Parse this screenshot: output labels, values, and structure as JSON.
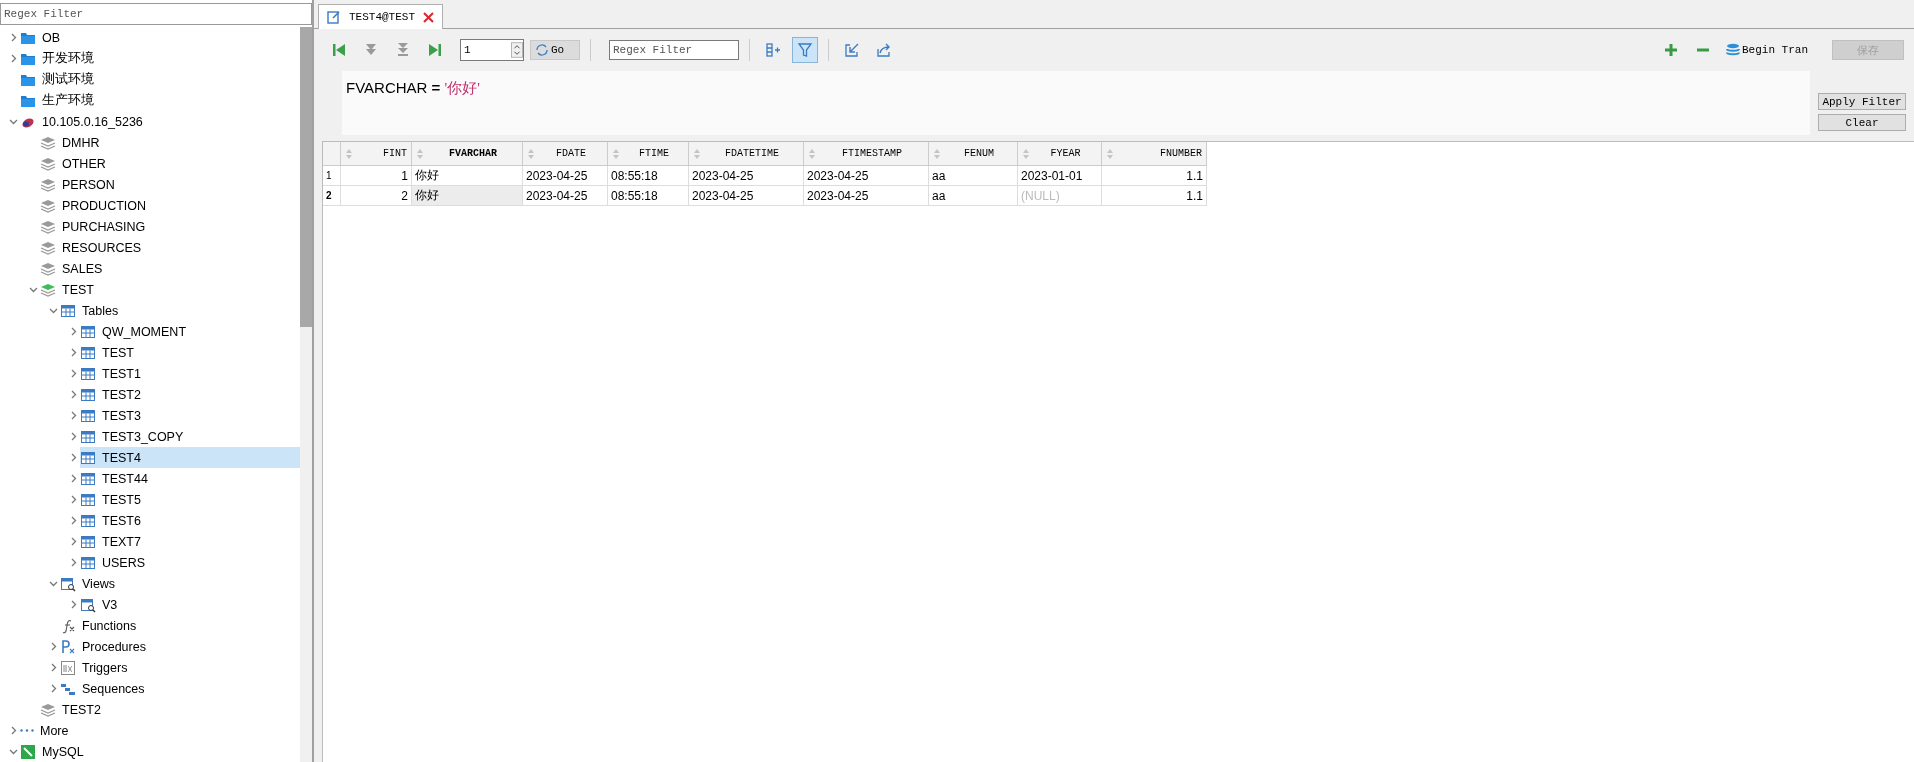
{
  "sidebar": {
    "filter": {
      "placeholder": "Regex Filter"
    },
    "tree": [
      {
        "label": "OB",
        "kind": "folder",
        "expanded": false,
        "selected": false
      },
      {
        "label": "开发环境",
        "kind": "folder",
        "expanded": false,
        "selected": false
      },
      {
        "label": "测试环境",
        "kind": "folder",
        "selected": false
      },
      {
        "label": "生产环境",
        "kind": "folder",
        "selected": false
      },
      {
        "label": "10.105.0.16_5236",
        "kind": "server",
        "expanded": true,
        "selected": false,
        "children": [
          {
            "label": "DMHR",
            "kind": "schema",
            "selected": false
          },
          {
            "label": "OTHER",
            "kind": "schema",
            "selected": false
          },
          {
            "label": "PERSON",
            "kind": "schema",
            "selected": false
          },
          {
            "label": "PRODUCTION",
            "kind": "schema",
            "selected": false
          },
          {
            "label": "PURCHASING",
            "kind": "schema",
            "selected": false
          },
          {
            "label": "RESOURCES",
            "kind": "schema",
            "selected": false
          },
          {
            "label": "SALES",
            "kind": "schema",
            "selected": false
          },
          {
            "label": "TEST",
            "kind": "schema-open",
            "expanded": true,
            "selected": false,
            "children": [
              {
                "label": "Tables",
                "kind": "table",
                "expanded": true,
                "selected": false,
                "children": [
                  {
                    "label": "QW_MOMENT",
                    "kind": "table",
                    "expanded": false,
                    "selected": false
                  },
                  {
                    "label": "TEST",
                    "kind": "table",
                    "expanded": false,
                    "selected": false
                  },
                  {
                    "label": "TEST1",
                    "kind": "table",
                    "expanded": false,
                    "selected": false
                  },
                  {
                    "label": "TEST2",
                    "kind": "table",
                    "expanded": false,
                    "selected": false
                  },
                  {
                    "label": "TEST3",
                    "kind": "table",
                    "expanded": false,
                    "selected": false
                  },
                  {
                    "label": "TEST3_COPY",
                    "kind": "table",
                    "expanded": false,
                    "selected": false
                  },
                  {
                    "label": "TEST4",
                    "kind": "table",
                    "expanded": false,
                    "selected": true
                  },
                  {
                    "label": "TEST44",
                    "kind": "table",
                    "expanded": false,
                    "selected": false
                  },
                  {
                    "label": "TEST5",
                    "kind": "table",
                    "expanded": false,
                    "selected": false
                  },
                  {
                    "label": "TEST6",
                    "kind": "table",
                    "expanded": false,
                    "selected": false
                  },
                  {
                    "label": "TEXT7",
                    "kind": "table",
                    "expanded": false,
                    "selected": false
                  },
                  {
                    "label": "USERS",
                    "kind": "table",
                    "expanded": false,
                    "selected": false
                  }
                ]
              },
              {
                "label": "Views",
                "kind": "view",
                "expanded": true,
                "selected": false,
                "children": [
                  {
                    "label": "V3",
                    "kind": "view",
                    "expanded": false,
                    "selected": false
                  }
                ]
              },
              {
                "label": "Functions",
                "kind": "function",
                "selected": false
              },
              {
                "label": "Procedures",
                "kind": "procedure",
                "expanded": false,
                "selected": false
              },
              {
                "label": "Triggers",
                "kind": "trigger",
                "expanded": false,
                "selected": false
              },
              {
                "label": "Sequences",
                "kind": "sequence",
                "expanded": false,
                "selected": false
              }
            ]
          },
          {
            "label": "TEST2",
            "kind": "schema",
            "selected": false
          }
        ]
      },
      {
        "label": "More",
        "kind": "more",
        "expanded": false,
        "selected": false
      },
      {
        "label": "MySQL",
        "kind": "mysql",
        "expanded": true,
        "selected": false
      }
    ]
  },
  "tabs": [
    {
      "title": "TEST4@TEST",
      "selected": true
    }
  ],
  "toolbar": {
    "nav": [
      {
        "kind": "first",
        "disabled": false
      },
      {
        "kind": "prev",
        "disabled": true
      },
      {
        "kind": "next",
        "disabled": true
      },
      {
        "kind": "last",
        "disabled": false
      }
    ],
    "page": "1",
    "go": "Go",
    "filter": {
      "placeholder": "Regex Filter"
    },
    "filter_on": true,
    "begin_tran": "Begin Tran",
    "save": {
      "label": "保存",
      "disabled": true
    }
  },
  "filter_expression": {
    "column": "FVARCHAR",
    "operator": "=",
    "value": "'你好'"
  },
  "apply_filter": "Apply Filter",
  "clear": "Clear",
  "table": {
    "columns": [
      {
        "name": "FINT",
        "kind": "number",
        "selected": false
      },
      {
        "name": "FVARCHAR",
        "kind": "text",
        "selected": true
      },
      {
        "name": "FDATE",
        "kind": "text",
        "selected": false
      },
      {
        "name": "FTIME",
        "kind": "text",
        "selected": false
      },
      {
        "name": "FDATETIME",
        "kind": "text",
        "selected": false
      },
      {
        "name": "FTIMESTAMP",
        "kind": "text",
        "selected": false
      },
      {
        "name": "FENUM",
        "kind": "text",
        "selected": false
      },
      {
        "name": "FYEAR",
        "kind": "text",
        "selected": false
      },
      {
        "name": "FNUMBER",
        "kind": "number",
        "selected": false
      }
    ],
    "rows": [
      {
        "number": "1",
        "selected": false,
        "cells": [
          {
            "text": "1",
            "null": false,
            "focused": false
          },
          {
            "text": "你好",
            "null": false,
            "focused": false
          },
          {
            "text": "2023-04-25",
            "null": false,
            "focused": false
          },
          {
            "text": "08:55:18",
            "null": false,
            "focused": false
          },
          {
            "text": "2023-04-25",
            "null": false,
            "focused": false
          },
          {
            "text": "2023-04-25",
            "null": false,
            "focused": false
          },
          {
            "text": "aa",
            "null": false,
            "focused": false
          },
          {
            "text": "2023-01-01",
            "null": false,
            "focused": false
          },
          {
            "text": "1.1",
            "null": false,
            "focused": false
          }
        ]
      },
      {
        "number": "2",
        "selected": true,
        "cells": [
          {
            "text": "2",
            "null": false,
            "focused": false
          },
          {
            "text": "你好",
            "null": false,
            "focused": true
          },
          {
            "text": "2023-04-25",
            "null": false,
            "focused": false
          },
          {
            "text": "08:55:18",
            "null": false,
            "focused": false
          },
          {
            "text": "2023-04-25",
            "null": false,
            "focused": false
          },
          {
            "text": "2023-04-25",
            "null": false,
            "focused": false
          },
          {
            "text": "aa",
            "null": false,
            "focused": false
          },
          {
            "text": "(NULL)",
            "null": true,
            "focused": false
          },
          {
            "text": "1.1",
            "null": false,
            "focused": false
          }
        ]
      }
    ]
  }
}
